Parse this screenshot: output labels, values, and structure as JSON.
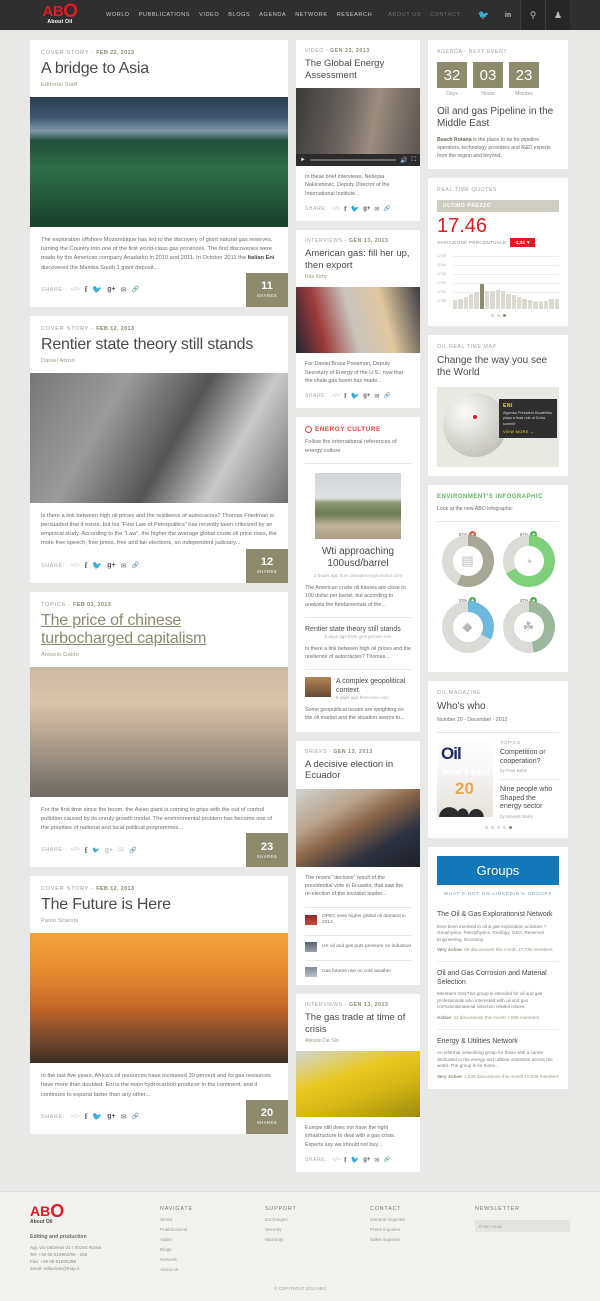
{
  "header": {
    "logo": {
      "ab": "AB",
      "o": "O",
      "sub": "About Oil"
    },
    "nav": [
      "WORLD",
      "PUBBLICATIONS",
      "VIDEO",
      "BLOGS",
      "AGENDA",
      "NETWORK",
      "RESEARCH"
    ],
    "subnav": [
      "ABOUT US",
      "CONTACT"
    ],
    "icons": [
      "twitter-icon",
      "linkedin-icon",
      "search-icon",
      "user-icon"
    ]
  },
  "left_articles": [
    {
      "kicker": "COVER STORY - ",
      "date": "Feb 22, 2013",
      "title": "A bridge to Asia",
      "byline": "Editorial Staff",
      "excerpt_a": "The exploration offshore Mozambique has led to the discovery of giant natural gas reserves, turning the Country into one of the first world-class gas provinces. The first discoveries were made by the American company Anadarko in 2010 and 2011. In October 2011 the ",
      "excerpt_b": "Italian Eni",
      "excerpt_c": " discovered the Mamba South 1 giant deposit...",
      "share_label": "SHARE:",
      "shares": "11",
      "shares_label": "SHARES",
      "underline": false
    },
    {
      "kicker": "COVER STORY - ",
      "date": "Feb 12, 2013",
      "title": "Rentier state theory still stands",
      "byline": "Daniel Atzori",
      "excerpt_a": "Is there a link between high oil prices and the resilience of autocracies? Thomas Friedman is persuaded that it exists, but his “First Law of Petropolitics” has recently been criticized by an empirical study. According to the “Law”, the higher the average global crude oil price rises, the more free speech, free press, free and fair elections, an independent judiciary...",
      "excerpt_b": "",
      "excerpt_c": "",
      "share_label": "SHARE:",
      "shares": "12",
      "shares_label": "SHARES",
      "underline": false
    },
    {
      "kicker": "TOPICS - ",
      "date": "Feb 03, 2013",
      "title": "The price of chinese turbocharged capitalism",
      "byline": "Antonio Galdo",
      "excerpt_a": "For the first time since the boom, the Asian giant is coming to grips with the out of control pollution caused by its unruly growth model. The environmental problem has become one of the priorities of national and local political programmes...",
      "excerpt_b": "",
      "excerpt_c": "",
      "share_label": "SHARE:",
      "shares": "23",
      "shares_label": "SHARES",
      "underline": true
    },
    {
      "kicker": "COVER STORY - ",
      "date": "Feb 12, 2013",
      "title": "The Future is Here",
      "byline": "Paolo Scaroni",
      "excerpt_a": "In the last five years, Africa's oil resources have increased 30 percent and its gas resources have more than doubled. Eni is the main hydrocarbon producer in the continent, and it continues to expand faster than any other...",
      "excerpt_b": "",
      "excerpt_c": "",
      "share_label": "SHARE:",
      "shares": "20",
      "shares_label": "SHARES",
      "underline": false
    }
  ],
  "mid": {
    "video": {
      "kicker": "VIDEO - ",
      "date": "Gen 23, 2013",
      "title": "The Global Energy Assessment",
      "excerpt": "In these brief interviews, Nebojsa Nakicenovic, Deputy Director of the International Institute...",
      "share_label": "SHARE:"
    },
    "interview1": {
      "kicker": "INTERVIEWS - ",
      "date": "Gen 13, 2013",
      "title": "American gas: fill her up, then export",
      "byline": "Rita Kirby",
      "excerpt": "For Daniel Bruce Poneman, Deputy Secretary of Energy of the U.S., now that the shale gas boom has made...",
      "share_label": "SHARE:"
    },
    "energy_culture": {
      "title": "ENERGY CULTURE",
      "subtitle": "Follow the international references of energy culture",
      "lead_title": "Wti approaching 100usd/barrel",
      "lead_meta_time": "2 hours ago from ",
      "lead_meta_src": "oilandenergyinvestor.com",
      "lead_text": "The American crude oil futures are close to 100 dollar per barrel, but according to analysts the fundamentals of the...",
      "items": [
        {
          "title": "Rentier state theory still stands",
          "meta_time": "3 days ago from ",
          "meta_src": "georgetown.edu",
          "text": "Is there a link between high oil prices and the resilience of autocracies? Thomas..."
        },
        {
          "title": "A complex geopolitical context",
          "meta_time": "9 days ago from ",
          "meta_src": "time.com",
          "text": "Some geopolitical issues are weighting on the oil market and the situation seems to..."
        }
      ]
    },
    "briefs": {
      "kicker": "BRIEFS - ",
      "date": "Gen 13, 2013",
      "title": "A decisive election in Ecuador",
      "excerpt": "The recent “decisive” result of the presidential vote in Ecuador, that saw the re-election of the socialist leader...",
      "list": [
        "OPEC sees higher global oil demand in 2013",
        "UK oil and gas puts pressure on industrial",
        "Gas futures rise on cold weather"
      ]
    },
    "interview2": {
      "kicker": "INTERVIEWS - ",
      "date": "Gen 13, 2013",
      "title": "The gas trade at time of crisis",
      "byline": "Alessio De Sio",
      "excerpt": "Europe still does not have the right infrastructure to deal with a gas crisis. Experts say we should not buy...",
      "share_label": "SHARE:"
    }
  },
  "right": {
    "agenda": {
      "kicker": "AGENDA - NEXT EVENT",
      "countdown": [
        {
          "value": "32",
          "label": "Days"
        },
        {
          "value": "03",
          "label": "Hours"
        },
        {
          "value": "23",
          "label": "Minutes"
        }
      ],
      "title": "Oil and gas Pipeline in the Middle East",
      "body_b": "Beach Rotana",
      "body": " is the place to be for pipeline operators, technology providers and R&D experts from the region and beyond."
    },
    "quotes": {
      "kicker": "REAL TIME QUOTES",
      "tab": "ULTIMO PREZZO",
      "value": "17.46",
      "var_label": "VARIAZIONE PERCENTUALE",
      "var_badge": "-1,34 ▼"
    },
    "map": {
      "kicker": "OIL REAL TIME MAP",
      "title": "Change the way you see the World",
      "tooltip_brand": "ENI",
      "tooltip_text": "Algerian President Bouteflika plays a lead role of Doha summit",
      "tooltip_more": "VIEW MORE →"
    },
    "infographic": {
      "title": "ENVIRONMENT'S INFOGRAPHIC",
      "subtitle": "Look at the new ABO infographic",
      "donuts": [
        {
          "pct": "57%",
          "color": "#a8a695",
          "bubble": "#e05a3a",
          "icon": "barrel-icon",
          "glyph": "▤"
        },
        {
          "pct": "67%",
          "color": "#7ed07a",
          "bubble": "#4caf50",
          "icon": "lightbulb-icon",
          "glyph": "◔"
        },
        {
          "pct": "33%",
          "color": "#6db8dd",
          "bubble": "#4caf50",
          "icon": "water-drop-icon",
          "glyph": "◆"
        },
        {
          "pct": "47%",
          "color": "#9cb89c",
          "bubble": "#4caf50",
          "icon": "tree-icon",
          "glyph": "☘"
        }
      ]
    },
    "magazine": {
      "kicker": "OIL MAGAZINE",
      "title": "Who's who",
      "issue": "Number 20 - December -  2012",
      "cover_brand": "Oil",
      "cover_title": "Who's who",
      "cover_num": "20",
      "topics_label": "TOPICS",
      "entries": [
        {
          "title": "Competition or cooperation?",
          "author": "by  Paul Betts"
        },
        {
          "title": "Nine people who Shaped the energy sector",
          "author": "by  Moisés Naím"
        }
      ]
    },
    "groups": {
      "banner": "Groups",
      "subtitle": "WHAT'S HOT ON LINKEDIN'S GROUPS",
      "items": [
        {
          "title": "The Oil & Gas Explorationist Network",
          "desc": "Ever been involved in oil & gas exploration activities ? Geophysics, Petrophysics, Geology, G&G, Reservoir Engineering, Economy,",
          "status": "Very Active",
          "stats": ": 89 discussions this month 17,735 members"
        },
        {
          "title": "Oil and Gas Corrosion and Material Selection",
          "desc": "Members OnlyThis group is intended for oil and gas professionals who interested with oil and gas corrosion&material selection related issues.",
          "status": "Active",
          "stats": ": 42 discussions this month  7,808 members"
        },
        {
          "title": "Energy & Utilities Network",
          "desc": "An informal networking group for those with a career dedicated to the energy and utilities industries across the world. The group is for those...",
          "status": "Very Active",
          "stats": ": 1,535 discussions this month 10,836 members"
        }
      ]
    }
  },
  "footer": {
    "logo_ab": "AB",
    "logo_o": "O",
    "logo_sub": "About Oil",
    "caption": "Editing and production",
    "address": "Agi, via Ostiense 21 / 00154 Roma\nTel: +39 06 519962/59 - 266\nFax: +39 06 51996288\nemail: editoriale@thap.it",
    "columns": [
      {
        "head": "NAVIGATE",
        "items": [
          "World",
          "Pubblications",
          "Video",
          "Blogs",
          "Network",
          "About us"
        ]
      },
      {
        "head": "SUPPORT",
        "items": [
          "Exchanges",
          "Security",
          "Warranty"
        ]
      },
      {
        "head": "CONTACT",
        "items": [
          "General inquiries",
          "Press inquiries",
          "Sales inquiries"
        ]
      }
    ],
    "newsletter_head": "NEWSLETTER",
    "newsletter_placeholder": "Enter email",
    "copyright": "© COPYRIGHT 2013 ABO"
  },
  "chart_data": {
    "type": "bar",
    "title": "Real time quotes - Ultimo prezzo",
    "ylabel": "",
    "xlabel": "",
    "ytick_labels": [
      "17.55",
      "17.54",
      "17.53",
      "17.52",
      "17.51",
      "17.50"
    ],
    "ylim": [
      17.495,
      17.555
    ],
    "grid": true,
    "legend": "none",
    "highlight_index": 5,
    "values": [
      17.507,
      17.509,
      17.512,
      17.515,
      17.518,
      17.529,
      17.519,
      17.52,
      17.521,
      17.519,
      17.516,
      17.514,
      17.511,
      17.509,
      17.507,
      17.505,
      17.504,
      17.506,
      17.509,
      17.509
    ]
  }
}
